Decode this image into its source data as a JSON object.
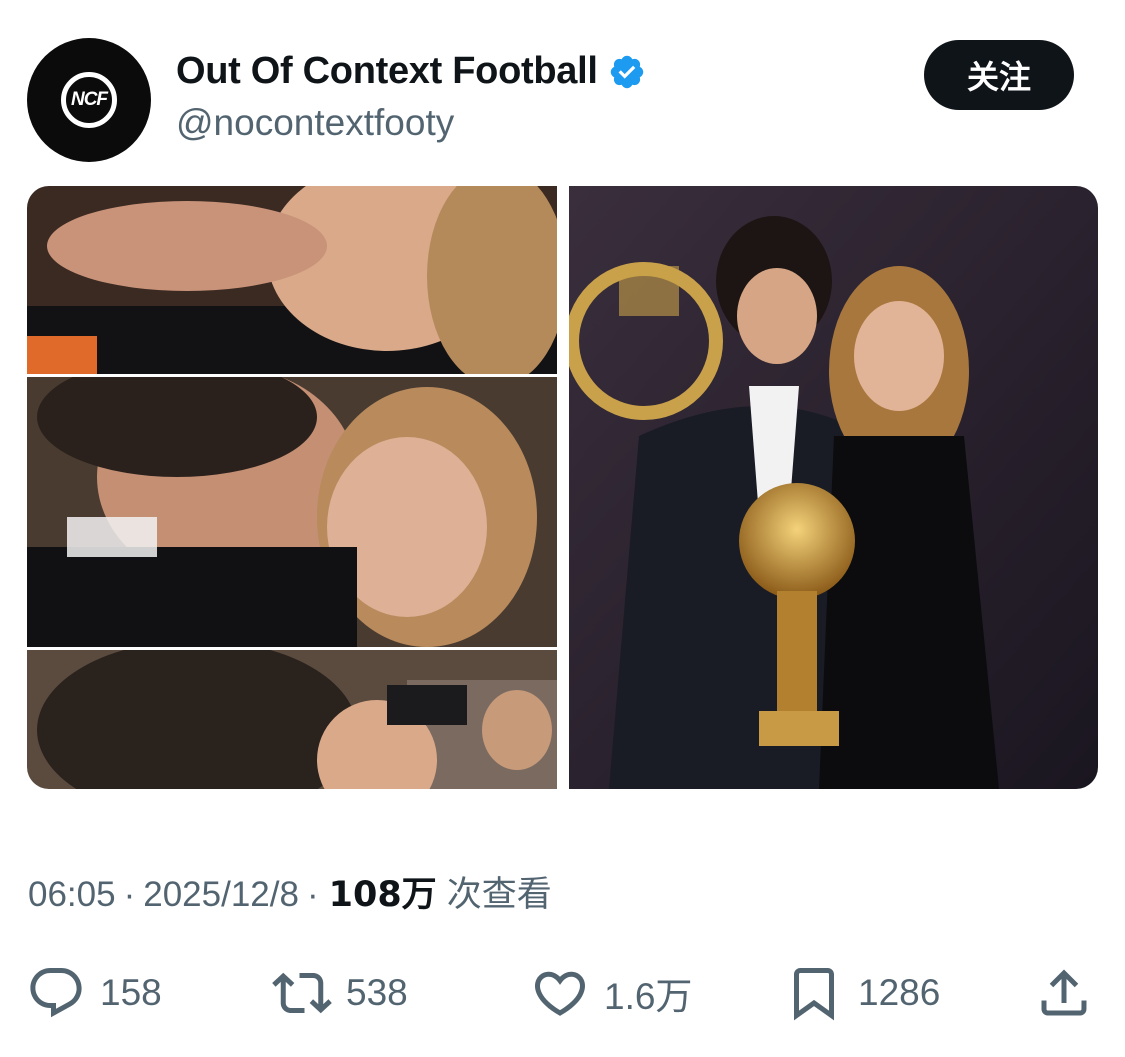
{
  "account": {
    "name": "Out Of Context Football",
    "handle": "@nocontextfooty",
    "avatar_text": "NCF",
    "verified": true
  },
  "follow_button": {
    "label": "关注"
  },
  "media": {
    "images": [
      {
        "description_icon": "photo-icon"
      },
      {
        "description_icon": "photo-icon"
      },
      {
        "description_icon": "photo-icon"
      },
      {
        "description_icon": "photo-icon"
      }
    ]
  },
  "meta": {
    "time": "06:05",
    "separator": "·",
    "date": "2025/12/8",
    "views": "108万",
    "views_suffix": "次查看"
  },
  "actions": {
    "reply_count": "158",
    "retweet_count": "538",
    "like_count": "1.6万",
    "bookmark_count": "1286"
  },
  "colors": {
    "text": "#0f1419",
    "secondary": "#536471",
    "verified": "#1d9bf0",
    "button": "#0f1419"
  }
}
